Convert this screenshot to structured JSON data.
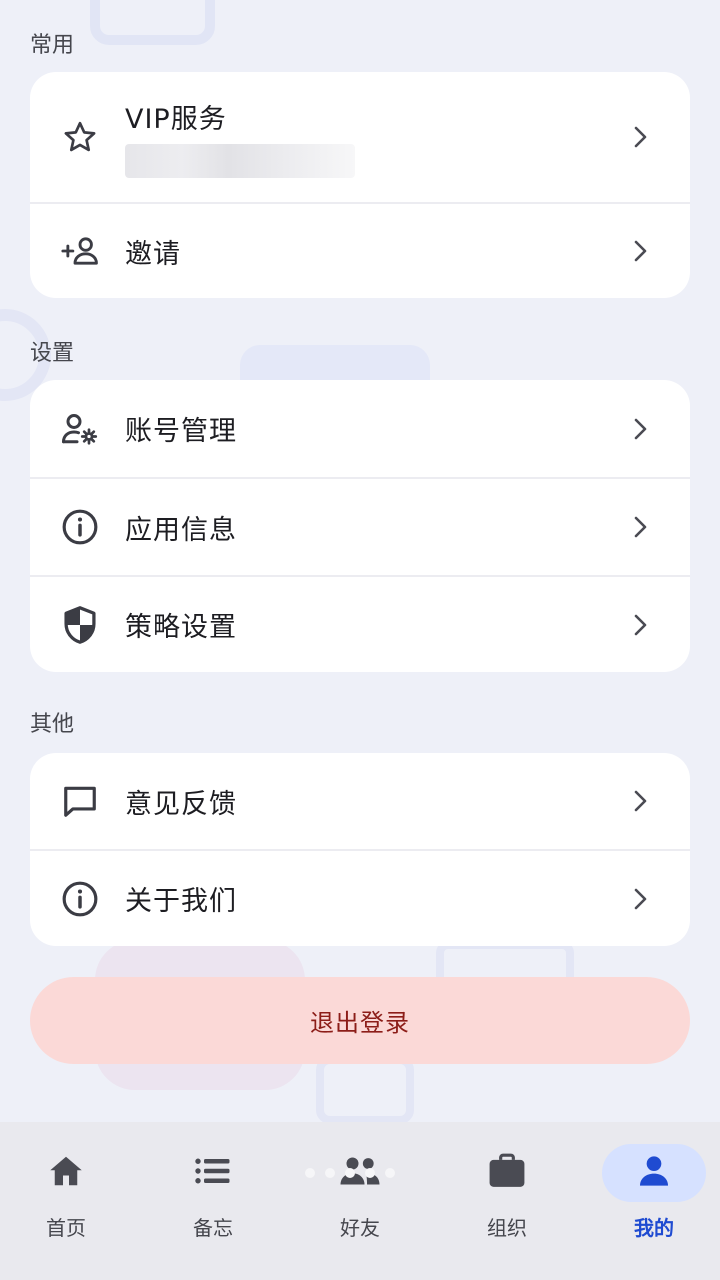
{
  "sections": {
    "common": {
      "title": "常用",
      "items": [
        {
          "label": "VIP服务",
          "icon": "star-icon"
        },
        {
          "label": "邀请",
          "icon": "add-person-icon"
        }
      ]
    },
    "settings": {
      "title": "设置",
      "items": [
        {
          "label": "账号管理",
          "icon": "account-settings-icon"
        },
        {
          "label": "应用信息",
          "icon": "info-icon"
        },
        {
          "label": "策略设置",
          "icon": "shield-icon"
        }
      ]
    },
    "other": {
      "title": "其他",
      "items": [
        {
          "label": "意见反馈",
          "icon": "feedback-icon"
        },
        {
          "label": "关于我们",
          "icon": "info-icon"
        }
      ]
    }
  },
  "logout_label": "退出登录",
  "bottom_nav": {
    "items": [
      {
        "label": "首页",
        "icon": "home-icon"
      },
      {
        "label": "备忘",
        "icon": "list-icon"
      },
      {
        "label": "好友",
        "icon": "people-icon"
      },
      {
        "label": "组织",
        "icon": "briefcase-icon"
      },
      {
        "label": "我的",
        "icon": "person-icon",
        "active": true
      }
    ]
  },
  "colors": {
    "accent": "#1f4bd1",
    "logout_bg": "#fbd9d7",
    "logout_text": "#8c1d18",
    "background": "#eef0f8"
  }
}
